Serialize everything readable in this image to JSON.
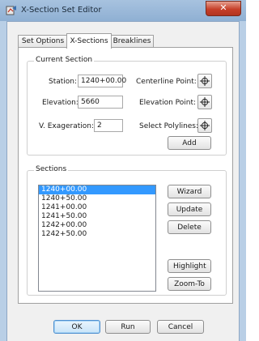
{
  "window": {
    "title": "X-Section Set Editor",
    "close_label": "✕"
  },
  "tabs": [
    {
      "label": "Set Options",
      "active": false
    },
    {
      "label": "X-Sections",
      "active": true
    },
    {
      "label": "Breaklines",
      "active": false
    }
  ],
  "current_section": {
    "title": "Current Section",
    "station_label": "Station:",
    "station_value": "1240+00.00",
    "elevation_label": "Elevation:",
    "elevation_value": "5660",
    "exaggeration_label": "V. Exageration:",
    "exaggeration_value": "2",
    "centerline_label": "Centerline Point:",
    "elevation_point_label": "Elevation Point:",
    "select_polylines_label": "Select Polylines:",
    "add_label": "Add",
    "pick_icon": "crosshair-icon"
  },
  "sections": {
    "title": "Sections",
    "items": [
      "1240+00.00",
      "1240+50.00",
      "1241+00.00",
      "1241+50.00",
      "1242+00.00",
      "1242+50.00"
    ],
    "selected_index": 0,
    "wizard_label": "Wizard",
    "update_label": "Update",
    "delete_label": "Delete",
    "highlight_label": "Highlight",
    "zoom_label": "Zoom-To"
  },
  "footer": {
    "ok_label": "OK",
    "run_label": "Run",
    "cancel_label": "Cancel"
  },
  "colors": {
    "selection": "#3399ff",
    "title_bar": "#9dbbdc",
    "close_button": "#c6402a"
  }
}
